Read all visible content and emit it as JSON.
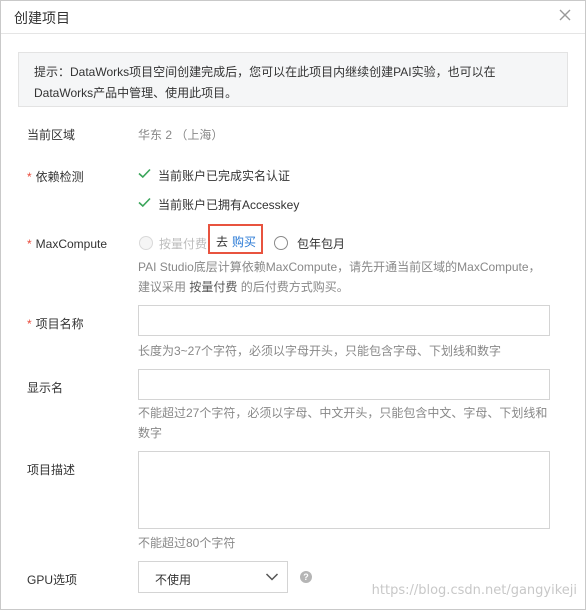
{
  "dialog": {
    "title": "创建项目"
  },
  "tip": {
    "line1": "提示：DataWorks项目空间创建完成后，您可以在此项目内继续创建PAI实验，也可以在",
    "line2": "DataWorks产品中管理、使用此项目。"
  },
  "region": {
    "label": "当前区域",
    "value": "华东 2 （上海）"
  },
  "dependency": {
    "required_mark": "*",
    "label": "依赖检测",
    "checks": [
      "当前账户已完成实名认证",
      "当前账户已拥有Accesskey"
    ]
  },
  "maxcompute": {
    "required_mark": "*",
    "label": "MaxCompute",
    "option_pay_as_you_go": "按量付费",
    "buy_prefix": "去",
    "buy_link": "购买",
    "option_subscription": "包年包月",
    "hint_line1": "PAI Studio底层计算依赖MaxCompute，请先开通当前区域的MaxCompute，",
    "hint_line2_a": "建议采用 ",
    "hint_line2_b": "按量付费",
    "hint_line2_c": " 的后付费方式购买。"
  },
  "project_name": {
    "required_mark": "*",
    "label": "项目名称",
    "value": "",
    "hint": "长度为3~27个字符，必须以字母开头，只能包含字母、下划线和数字"
  },
  "display_name": {
    "label": "显示名",
    "value": "",
    "hint_line1": "不能超过27个字符，必须以字母、中文开头，只能包含中文、字母、下划线和",
    "hint_line2": "数字"
  },
  "description": {
    "label": "项目描述",
    "value": "",
    "hint": "不能超过80个字符"
  },
  "gpu": {
    "label": "GPU选项",
    "selected": "不使用"
  },
  "watermark": "https://blog.csdn.net/gangyikeji",
  "colors": {
    "accent": "#2a7ad6",
    "check": "#3aa55a",
    "required": "#e94b3c",
    "highlight_box": "#e8533f"
  }
}
